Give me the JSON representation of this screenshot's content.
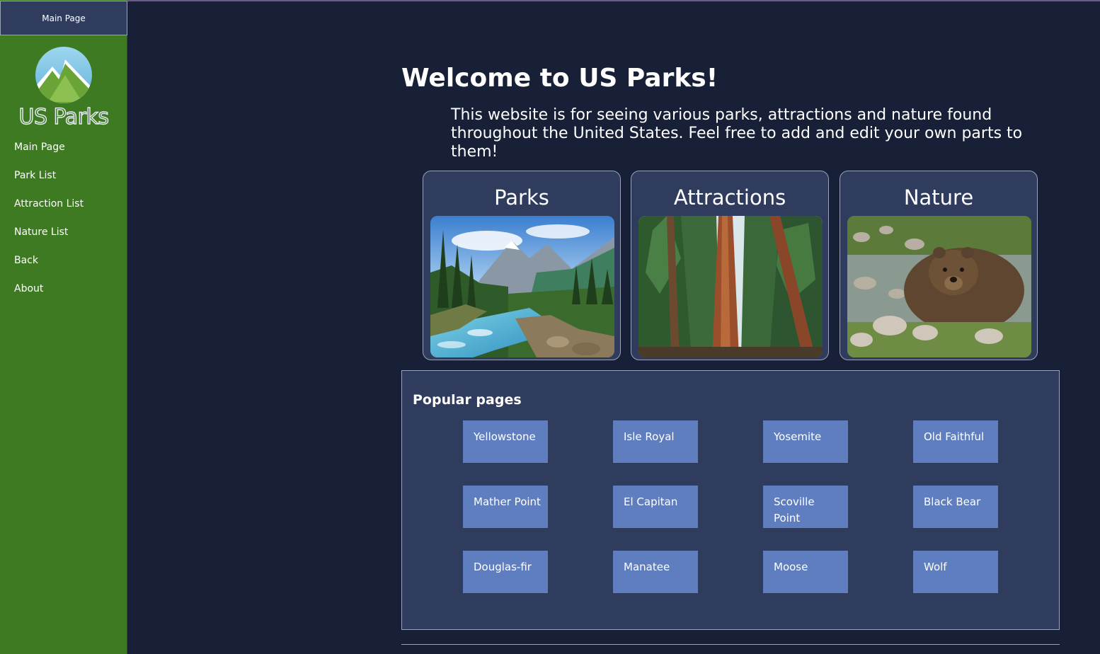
{
  "sidebar": {
    "header": "Main Page",
    "logo_text": "US Parks",
    "items": [
      {
        "label": "Main Page"
      },
      {
        "label": "Park List"
      },
      {
        "label": "Attraction List"
      },
      {
        "label": "Nature List"
      },
      {
        "label": "Back"
      },
      {
        "label": "About"
      }
    ]
  },
  "main": {
    "title": "Welcome to US Parks!",
    "intro": "This website is for seeing various parks, attractions and nature found throughout the United States. Feel free to add and edit your own parts to them!",
    "cards": [
      {
        "title": "Parks",
        "image": "mountain-river-photo"
      },
      {
        "title": "Attractions",
        "image": "giant-sequoia-photo"
      },
      {
        "title": "Nature",
        "image": "grizzly-bear-photo"
      }
    ],
    "popular": {
      "title": "Popular pages",
      "items": [
        "Yellowstone",
        "Isle Royal",
        "Yosemite",
        "Old Faithful",
        "Mather Point",
        "El Capitan",
        "Scoville Point",
        "Black Bear",
        "Douglas-fir",
        "Manatee",
        "Moose",
        "Wolf"
      ]
    }
  },
  "colors": {
    "background": "#172036",
    "sidebar": "#3d7a22",
    "panel": "#2f3c5e",
    "tile": "#5f7ebf",
    "border": "#9aa3b8"
  }
}
